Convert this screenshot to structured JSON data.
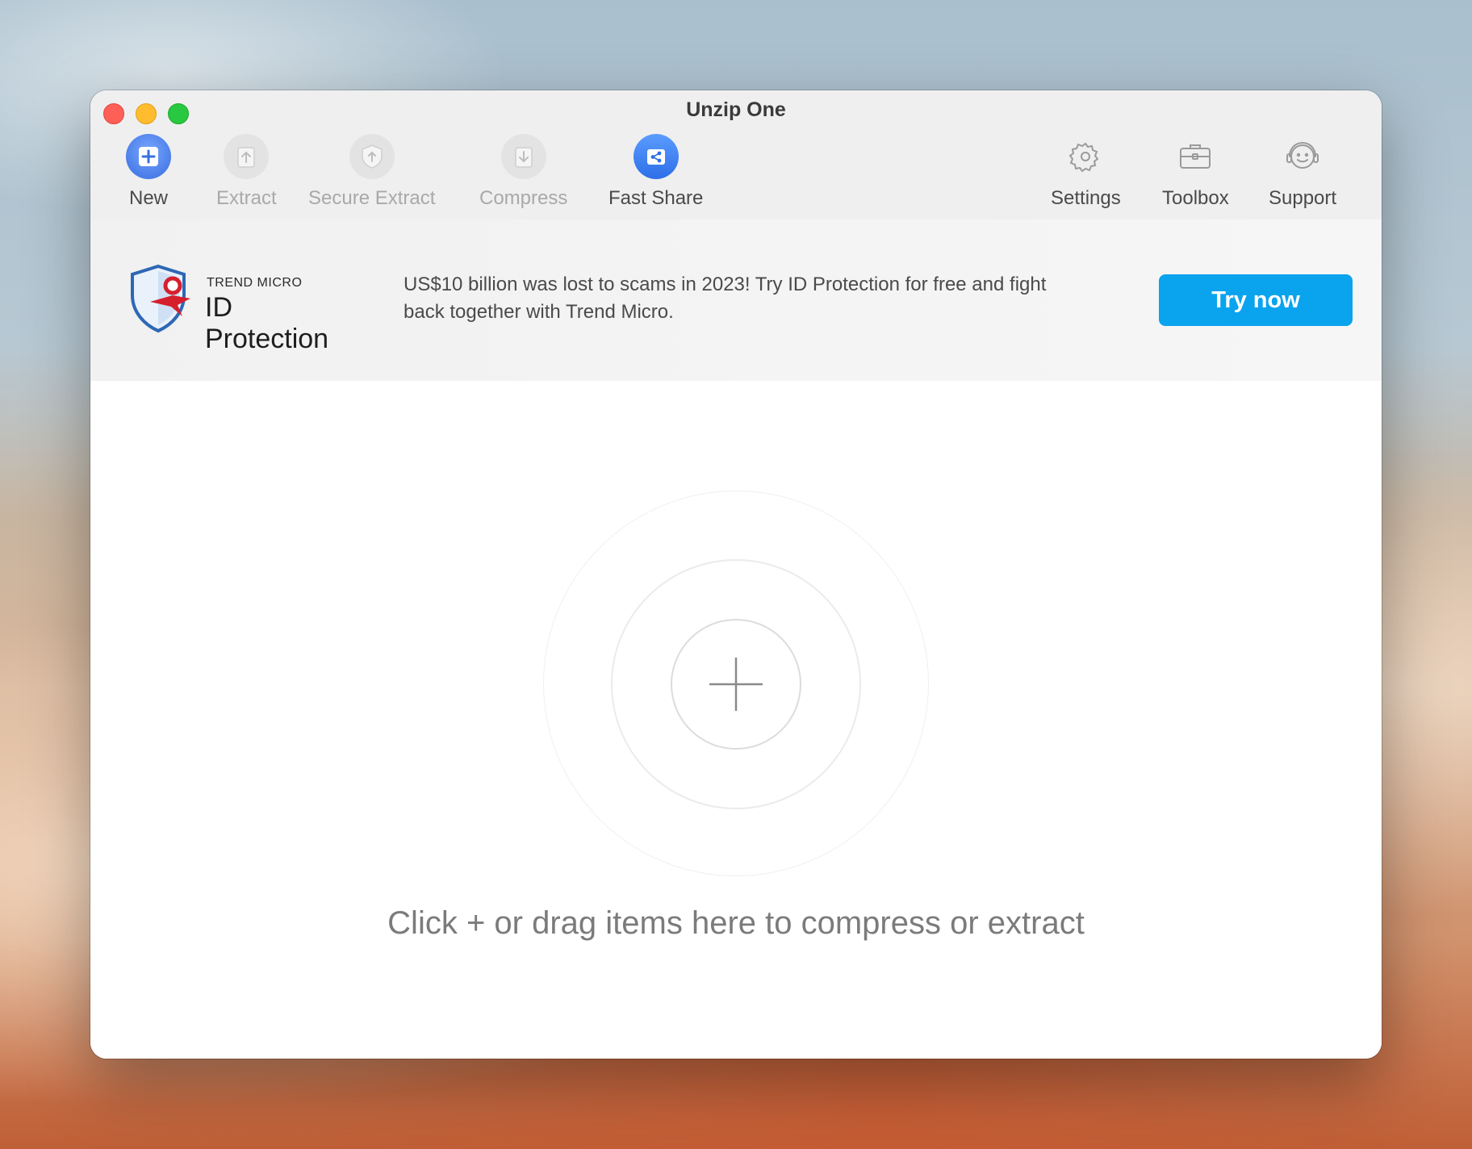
{
  "window": {
    "title": "Unzip One"
  },
  "toolbar": {
    "left": [
      {
        "id": "new",
        "label": "New",
        "icon": "new-archive-icon",
        "enabled": true
      },
      {
        "id": "extract",
        "label": "Extract",
        "icon": "extract-icon",
        "enabled": false
      },
      {
        "id": "secure_extract",
        "label": "Secure Extract",
        "icon": "shield-extract-icon",
        "enabled": false
      },
      {
        "id": "compress",
        "label": "Compress",
        "icon": "compress-icon",
        "enabled": false
      },
      {
        "id": "fast_share",
        "label": "Fast Share",
        "icon": "share-icon",
        "enabled": true
      }
    ],
    "right": [
      {
        "id": "settings",
        "label": "Settings",
        "icon": "gear-icon"
      },
      {
        "id": "toolbox",
        "label": "Toolbox",
        "icon": "toolbox-icon"
      },
      {
        "id": "support",
        "label": "Support",
        "icon": "headset-icon"
      }
    ]
  },
  "banner": {
    "brand_small": "TREND MICRO",
    "brand_big": "ID Protection",
    "message": "US$10 billion was lost to scams in 2023! Try ID Protection for free and fight back together with Trend Micro.",
    "cta_label": "Try now",
    "cta_color": "#0aa3ee"
  },
  "dropzone": {
    "hint": "Click + or drag items here to compress or extract"
  }
}
